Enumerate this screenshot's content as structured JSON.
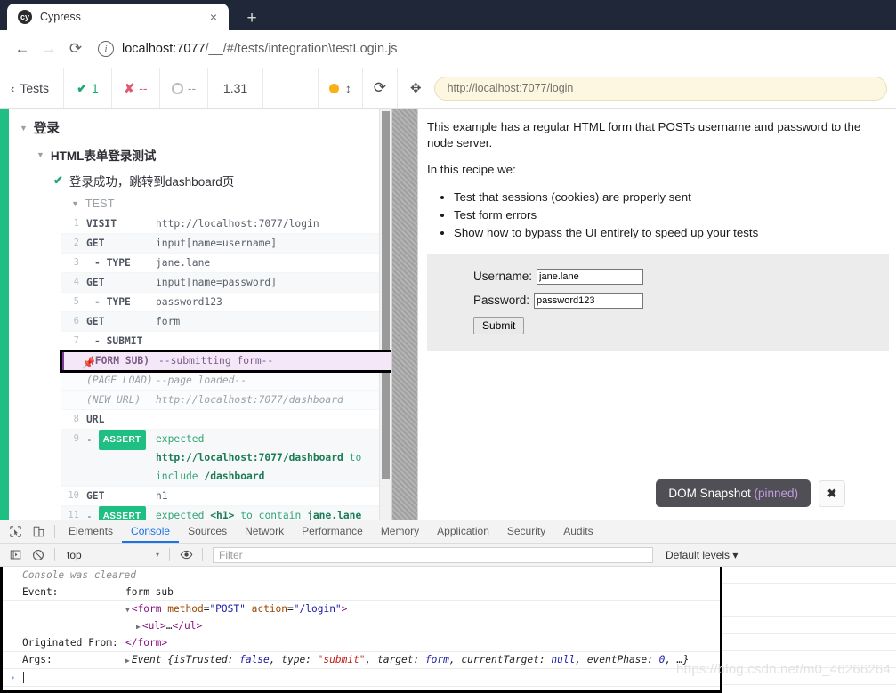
{
  "browser": {
    "tab": {
      "title": "Cypress",
      "favicon": "cy",
      "close_icon": "×"
    },
    "new_tab_icon": "+",
    "nav": {
      "back_icon": "←",
      "forward_icon": "→",
      "reload_icon": "⟳"
    },
    "url": {
      "info_icon": "i",
      "host": "localhost:7077",
      "path": "/__/#/tests/integration\\testLogin.js"
    }
  },
  "cypress_header": {
    "back_label": "Tests",
    "back_chevron": "‹",
    "stats": {
      "passed_icon": "✔",
      "passed": "1",
      "failed_icon": "✘",
      "failed": "--",
      "pending_icon": "ring",
      "pending": "--",
      "duration": "1.31"
    },
    "selector_playground_icon": "orange-dot",
    "selector_resize_icon": "↕",
    "restart_icon": "⟳",
    "crosshair_icon": "✥",
    "aut_url": "http://localhost:7077/login"
  },
  "reporter": {
    "suite": {
      "triangle": "▼",
      "title": "登录"
    },
    "subsuite": {
      "triangle": "▼",
      "title": "HTML表单登录测试"
    },
    "test": {
      "check": "✔",
      "title": "登录成功，跳转到dashboard页"
    },
    "hooks": {
      "triangle": "▼",
      "label": "TEST"
    },
    "commands": [
      {
        "num": "1",
        "name": "VISIT",
        "msg": "http://localhost:7077/login",
        "kind": "normal",
        "indent": false
      },
      {
        "num": "2",
        "name": "GET",
        "msg": "input[name=username]",
        "kind": "normal",
        "indent": false
      },
      {
        "num": "3",
        "name": "- TYPE",
        "msg": "jane.lane",
        "kind": "normal",
        "indent": true
      },
      {
        "num": "4",
        "name": "GET",
        "msg": "input[name=password]",
        "kind": "normal",
        "indent": false
      },
      {
        "num": "5",
        "name": "- TYPE",
        "msg": "password123",
        "kind": "normal",
        "indent": true
      },
      {
        "num": "6",
        "name": "GET",
        "msg": "form",
        "kind": "normal",
        "indent": false
      },
      {
        "num": "7",
        "name": "- SUBMIT",
        "msg": "",
        "kind": "normal",
        "indent": true
      },
      {
        "num": "",
        "name": "(FORM SUB)",
        "msg": "--submitting form--",
        "kind": "pinned",
        "pin_icon": "📌"
      },
      {
        "num": "",
        "name": "(PAGE LOAD)",
        "msg": "--page loaded--",
        "kind": "event"
      },
      {
        "num": "",
        "name": "(NEW URL)",
        "msg": "http://localhost:7077/dashboard",
        "kind": "event"
      },
      {
        "num": "8",
        "name": "URL",
        "msg": "",
        "kind": "normal",
        "indent": false
      },
      {
        "num": "9",
        "name": "-",
        "badge": "ASSERT",
        "msg_html": "expected <b>http://localhost:7077/dashboard</b> to include <b>/dashboard</b>",
        "kind": "assert"
      },
      {
        "num": "10",
        "name": "GET",
        "msg": "h1",
        "kind": "normal",
        "indent": false
      },
      {
        "num": "11",
        "name": "-",
        "badge": "ASSERT",
        "msg_html": "expected <b>&lt;h1&gt;</b> to contain <b>jane.lane</b>",
        "kind": "assert"
      }
    ]
  },
  "aut": {
    "intro": "This example has a regular HTML form that POSTs username and password to the node server.",
    "recipe_lead": "In this recipe we:",
    "bullets": [
      "Test that sessions (cookies) are properly sent",
      "Test form errors",
      "Show how to bypass the UI entirely to speed up your tests"
    ],
    "form": {
      "username_label": "Username:",
      "username_value": "jane.lane",
      "password_label": "Password:",
      "password_value": "password123",
      "submit_label": "Submit"
    },
    "snapshot": {
      "label": "DOM Snapshot",
      "state": "(pinned)",
      "close_icon": "✖"
    }
  },
  "devtools": {
    "inspect_icon": "⬚",
    "device_icon": "⬜",
    "tabs": [
      {
        "label": "Elements",
        "active": false
      },
      {
        "label": "Console",
        "active": true
      },
      {
        "label": "Sources",
        "active": false
      },
      {
        "label": "Network",
        "active": false
      },
      {
        "label": "Performance",
        "active": false
      },
      {
        "label": "Memory",
        "active": false
      },
      {
        "label": "Application",
        "active": false
      },
      {
        "label": "Security",
        "active": false
      },
      {
        "label": "Audits",
        "active": false
      }
    ],
    "filterbar": {
      "sidebar_icon": "▶",
      "clear_icon": "⃠",
      "context": "top",
      "context_caret": "▾",
      "eye_icon": "◉",
      "filter_placeholder": "Filter",
      "levels": "Default levels",
      "levels_caret": "▾"
    },
    "console": {
      "cleared_text": "Console was cleared",
      "rows": [
        {
          "label": "Event:",
          "value": "form sub"
        },
        {
          "label": "",
          "value_html": "html-form"
        },
        {
          "label": "Originated From:",
          "value_html": "close-form"
        },
        {
          "label": "Args:",
          "value_html": "event-args"
        }
      ],
      "form_open": "<form method=\"POST\" action=\"/login\">",
      "form_ul": "<ul>…</ul>",
      "form_close": "</form>",
      "args_text": "Event {isTrusted: false, type: \"submit\", target: form, currentTarget: null, eventPhase: 0, …}",
      "prompt_caret": "›"
    }
  },
  "watermark": "https://blog.csdn.net/m0_46266264",
  "colors": {
    "accent_green": "#1fbe83",
    "pass_green": "#1fa971",
    "fail_red": "#e45770",
    "pinned_purple": "#7c3b9a",
    "orange_dot": "#f8b218",
    "devtools_blue": "#1a73e8"
  }
}
